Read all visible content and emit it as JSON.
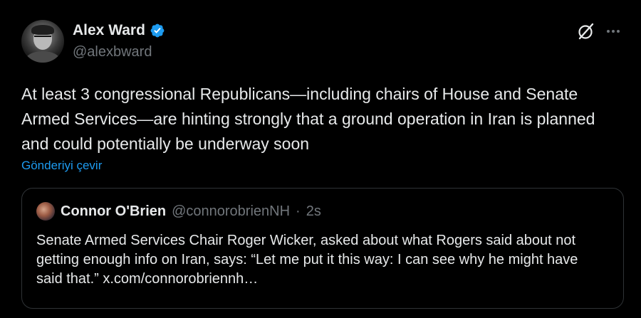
{
  "author": {
    "display_name": "Alex Ward",
    "handle": "@alexbward",
    "verified": true,
    "verified_color": "#1d9bf0"
  },
  "icons": {
    "verified": "verified-badge-icon",
    "grok": "grok-icon",
    "more": "more-options-icon"
  },
  "tweet": {
    "text": "At least 3 congressional Republicans—including chairs of House and Senate Armed Services—are hinting strongly that a ground operation in Iran is planned and could potentially be underway soon",
    "translate_label": "Gönderiyi çevir"
  },
  "quote": {
    "display_name": "Connor O'Brien",
    "handle": "@connorobrienNH",
    "separator": "·",
    "time": "2s",
    "text": "Senate Armed Services Chair Roger Wicker, asked about what Rogers said about not getting enough info on Iran, says: “Let me put it this way: I can see why he might have said that.” x.com/connorobriennh…"
  },
  "colors": {
    "background": "#000000",
    "primary_text": "#e7e9ea",
    "secondary_text": "#71767b",
    "link": "#1d9bf0",
    "border": "#2f3336"
  }
}
